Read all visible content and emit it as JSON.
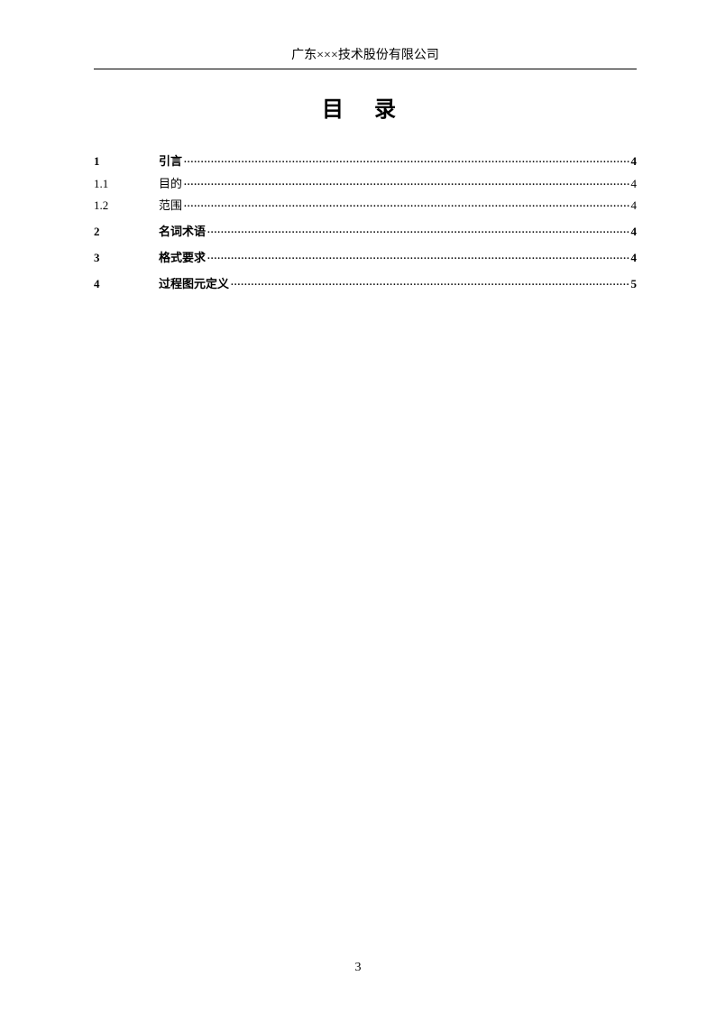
{
  "header": {
    "company": "广东×××技术股份有限公司"
  },
  "title": "目  录",
  "toc": {
    "items": [
      {
        "num": "1",
        "label": "引言",
        "page": "4",
        "level": 1
      },
      {
        "num": "1.1",
        "label": "目的",
        "page": "4",
        "level": 2
      },
      {
        "num": "1.2",
        "label": "范围",
        "page": "4",
        "level": 2
      },
      {
        "num": "2",
        "label": "名词术语",
        "page": "4",
        "level": 1
      },
      {
        "num": "3",
        "label": "格式要求",
        "page": "4",
        "level": 1
      },
      {
        "num": "4",
        "label": "过程图元定义",
        "page": "5",
        "level": 1
      }
    ]
  },
  "footer": {
    "page_number": "3"
  }
}
